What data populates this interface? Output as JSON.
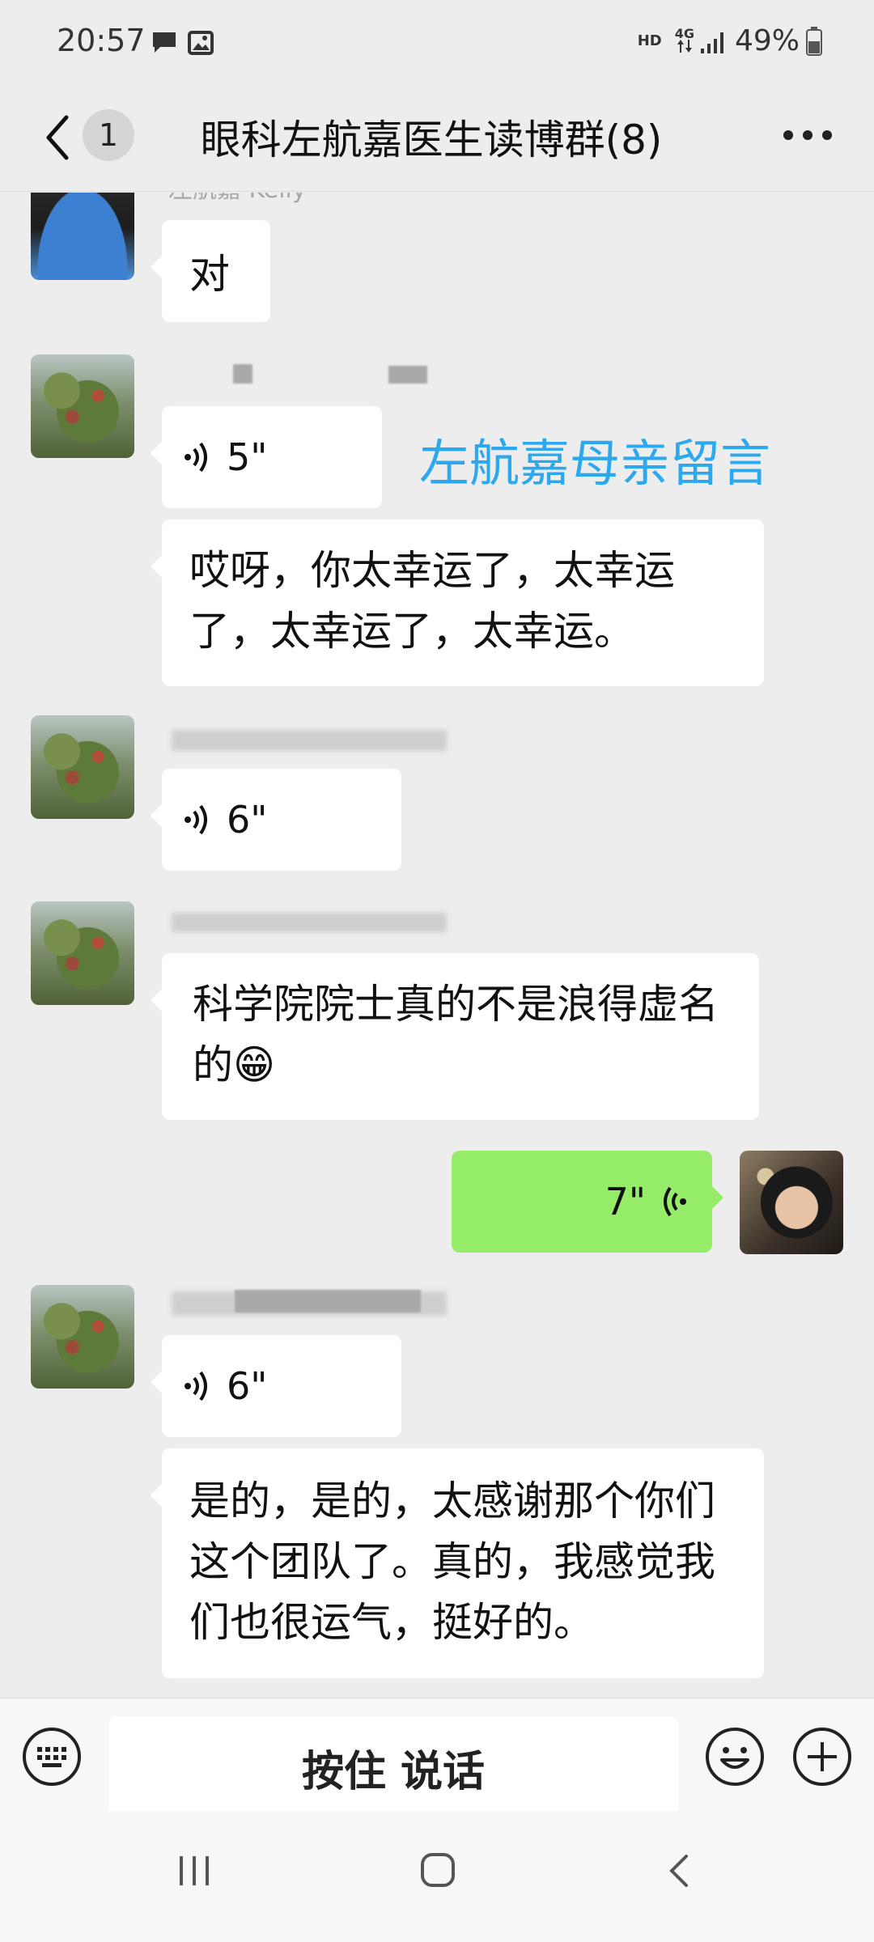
{
  "status_bar": {
    "time": "20:57",
    "hd": "HD",
    "network": "4G",
    "battery_pct": "49%"
  },
  "header": {
    "unread_count": "1",
    "title": "眼科左航嘉医生读博群(8)"
  },
  "messages": [
    {
      "sender": "左航嘉 Kelly",
      "type": "text",
      "direction": "in",
      "text": "对",
      "avatar": "blue-dress-photo"
    },
    {
      "sender": "",
      "type": "voice",
      "direction": "in",
      "duration": "5\"",
      "avatar": "tree-photo"
    },
    {
      "sender": "",
      "type": "text",
      "direction": "in",
      "text": "哎呀，你太幸运了，太幸运了，太幸运了，太幸运。"
    },
    {
      "sender": "",
      "type": "voice",
      "direction": "in",
      "duration": "6\"",
      "avatar": "tree-photo"
    },
    {
      "sender": "",
      "type": "text",
      "direction": "in",
      "text": "科学院院士真的不是浪得虚名的😁",
      "avatar": "tree-photo"
    },
    {
      "sender": "",
      "type": "voice",
      "direction": "out",
      "duration": "7\"",
      "avatar": "self-photo"
    },
    {
      "sender": "",
      "type": "voice",
      "direction": "in",
      "duration": "6\"",
      "avatar": "tree-photo"
    },
    {
      "sender": "",
      "type": "text",
      "direction": "in",
      "text": "是的，是的，太感谢那个你们这个团队了。真的，我感觉我们也很运气，挺好的。"
    }
  ],
  "annotation": "左航嘉母亲留言",
  "input_bar": {
    "hold_to_talk": "按住 说话"
  },
  "colors": {
    "background": "#ededed",
    "bubble_in": "#ffffff",
    "bubble_out": "#95ec69",
    "annotation": "#2ba8ee"
  }
}
